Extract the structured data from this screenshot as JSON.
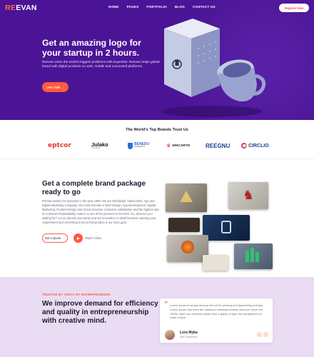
{
  "brand": {
    "name_part1": "RE",
    "name_part2": "EVAN"
  },
  "nav": {
    "items": [
      "HOME",
      "PAGES",
      "PORTFOLIO",
      "BLOG",
      "CONTACT US"
    ],
    "register_label": "Register Now"
  },
  "hero": {
    "title": "Get an amazing logo for your startup in 2 hours.",
    "description": "Reevan solve the world's biggest problems with Expertise. Reevan helps global brand with digital products on web, mobile and connected platforms.",
    "cta_label": "Let's Talk",
    "cta_icon": "arrow-right-icon"
  },
  "brands": {
    "title": "The World's Top Brands Trust Us",
    "logos": [
      "eptcor",
      "Julako",
      "BENEDU",
      "WHCARTD",
      "REEGNU",
      "CIRCLIO"
    ],
    "julako_sub": "STUDIO",
    "benedu_sub": "UNIVERSITY"
  },
  "package": {
    "title": "Get a complete brand package ready to go",
    "description": "Reevan started its operation in the year 1999. We are Worldwide, based Web, App and Digital Marketing Company. Our main Domain is Web Design, App Development, Digital Marketing, Product Design and Cloud Services. Customer satisfaction and the highest rate of Customer Repeatability makes us one of the pioneers in the field. So, what are you waiting for? Let us discuss your ideas and our innovation in detail because catering your requirement and converting it into a final product is our main goal.",
    "quote_label": "Get a Quote",
    "watch_label": "Watch Video"
  },
  "testimonial": {
    "kicker": "TRUSTED BY 1000'S OF ENTREPRENEURS",
    "title": "We improve demand for efficiency and quality in entrepreneurship with creative mind.",
    "quote": "Lorem Ipsum is simply dummy text of the printing and typesetting industry. Lorem Ipsum has been the industry's standard dummy text ever since the 1500s, when an unknown printer took a galley of type and scrambled it to make a type.",
    "author": "Lora Myka",
    "role": "ABC Business"
  },
  "colors": {
    "primary_purple": "#4b1496",
    "accent_orange": "#ff5a3c",
    "lavender": "#eadcf3"
  }
}
